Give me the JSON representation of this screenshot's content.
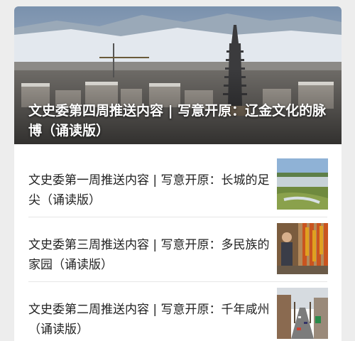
{
  "featured": {
    "title": "文史委第四周推送内容 | 写意开原：辽金文化的脉博（诵读版）",
    "image_icon": "pagoda-city-photo"
  },
  "articles": [
    {
      "title": "文史委第一周推送内容 | 写意开原：长城的足尖（诵读版）",
      "thumb_icon": "landscape-river-photo"
    },
    {
      "title": "文史委第三周推送内容 | 写意开原：多民族的家园（诵读版）",
      "thumb_icon": "people-corn-photo"
    },
    {
      "title": "文史委第二周推送内容 | 写意开原：千年咸州（诵读版）",
      "thumb_icon": "street-photo"
    }
  ],
  "colors": {
    "page_bg": "#ededed",
    "card_bg": "#ffffff",
    "text": "#222222"
  }
}
